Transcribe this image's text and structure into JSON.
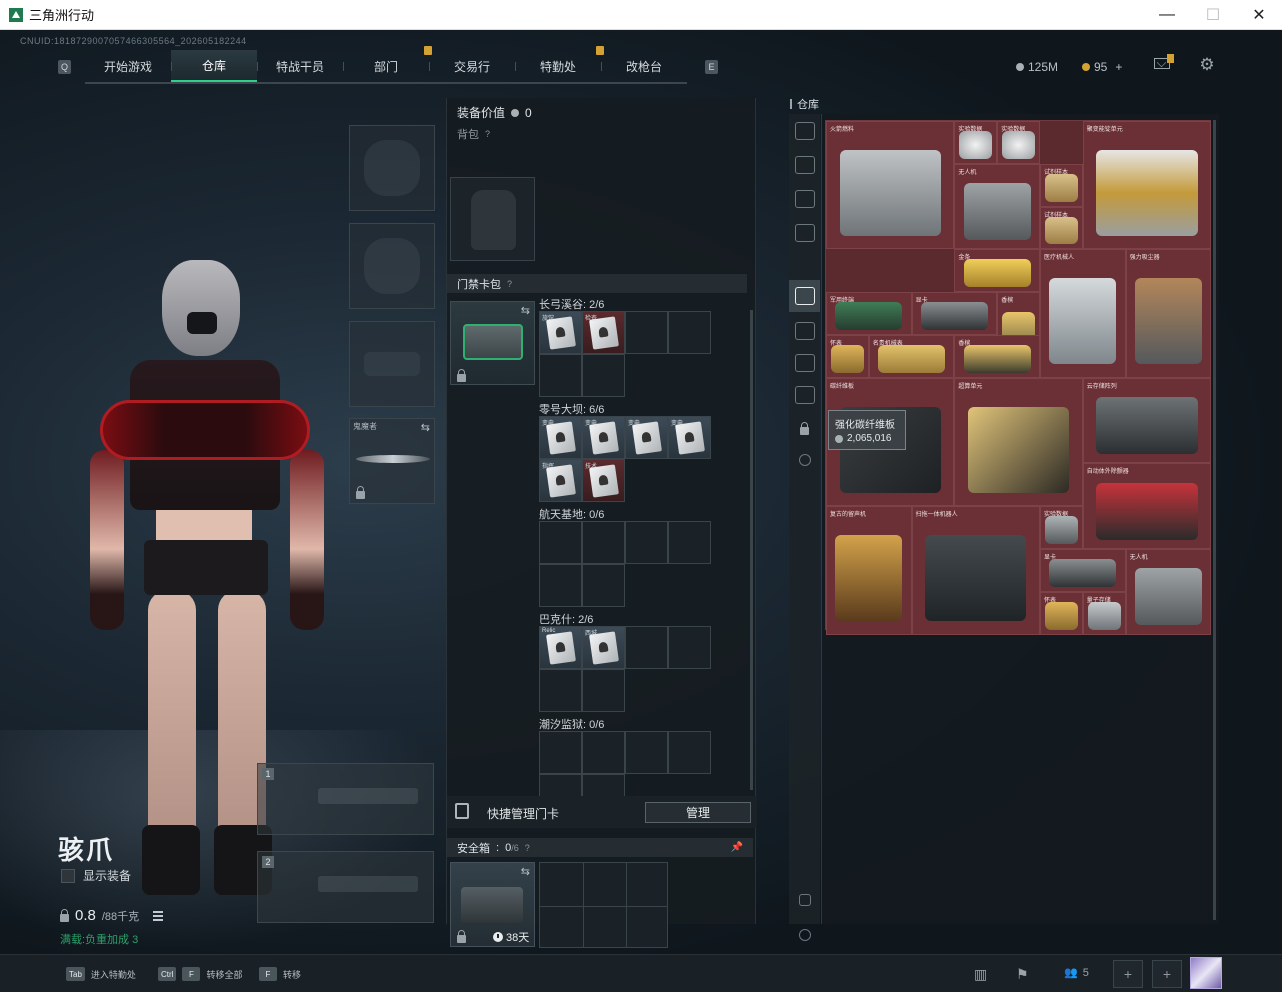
{
  "window": {
    "title": "三角洲行动",
    "minimize": "—",
    "maximize": "☐",
    "close": "✕"
  },
  "cnuid": "CNUID:1818729007057466305564_202605182244",
  "nav": {
    "left_key": "Q",
    "right_key": "E",
    "tabs": [
      {
        "label": "开始游戏",
        "badge": false
      },
      {
        "label": "仓库",
        "badge": false,
        "active": true
      },
      {
        "label": "特战干员",
        "badge": false
      },
      {
        "label": "部门",
        "badge": true
      },
      {
        "label": "交易行",
        "badge": false
      },
      {
        "label": "特勤处",
        "badge": true
      },
      {
        "label": "改枪台",
        "badge": false
      }
    ]
  },
  "currency": {
    "silver": "125M",
    "gold": "95",
    "gold_add": "+"
  },
  "operator": {
    "name": "骇爪",
    "show_equipment": "显示装备",
    "weight_current": "0.8",
    "weight_max": "/88千克",
    "stat_line": "满载:负重加成 3"
  },
  "equipment": {
    "melee_label": "鬼魔者"
  },
  "weapon_slots": [
    "1",
    "2"
  ],
  "middle": {
    "equip_value_label": "装备价值",
    "equip_value": "0",
    "backpack_label": "背包",
    "keycard_label": "门禁卡包",
    "maps": [
      {
        "label": "长弓溪谷: 2/6"
      },
      {
        "label": "零号大坝: 6/6"
      },
      {
        "label": "航天基地: 0/6"
      },
      {
        "label": "巴克什: 2/6"
      },
      {
        "label": "潮汐监狱: 0/6"
      }
    ],
    "card_labels": {
      "longbow": [
        "旅馆",
        "检查"
      ],
      "dam": [
        "变电",
        "变电",
        "变电",
        "变电",
        "指挥",
        "技术"
      ],
      "bakesh": [
        "Relic",
        "西城"
      ]
    },
    "quick_manage": "快捷管理门卡",
    "manage_button": "管理",
    "safe_label": "安全箱",
    "safe_count": "0",
    "safe_capacity": "/6",
    "safe_time": "38天"
  },
  "warehouse": {
    "title": "仓库",
    "items": [
      {
        "name": "火箭燃料"
      },
      {
        "name": "实验数据"
      },
      {
        "name": "实验数据"
      },
      {
        "name": "聚变能锭单元"
      },
      {
        "name": "无人机"
      },
      {
        "name": "试剂样本"
      },
      {
        "name": "试剂样本"
      },
      {
        "name": "金条"
      },
      {
        "name": "医疗机械人"
      },
      {
        "name": "强力吸尘器"
      },
      {
        "name": "军用终端"
      },
      {
        "name": "显卡"
      },
      {
        "name": "香槟"
      },
      {
        "name": "怀表"
      },
      {
        "name": "名贵机械表"
      },
      {
        "name": "香槟"
      },
      {
        "name": "碳纤维板"
      },
      {
        "name": "超算单元"
      },
      {
        "name": "云存储阵列"
      },
      {
        "name": "自动体外除颤器"
      },
      {
        "name": "复古的留声机"
      },
      {
        "name": "扫拖一体机器人"
      },
      {
        "name": "实验数据"
      },
      {
        "name": "显卡"
      },
      {
        "name": "无人机"
      },
      {
        "name": "怀表"
      },
      {
        "name": "量子存储"
      }
    ],
    "tooltip_name": "强化碳纤维板",
    "tooltip_value": "2,065,016"
  },
  "bottom": {
    "hints": [
      {
        "key": "Tab",
        "label": "进入特勤处"
      },
      {
        "key": "Ctrl",
        "key2": "F",
        "label": "转移全部"
      },
      {
        "key": "F",
        "label": "转移"
      }
    ],
    "friends_count": "5",
    "plus": "+"
  },
  "colors": {
    "accent_green": "#2fd08a",
    "badge_gold": "#d3a233",
    "warehouse_red": "#6a3035"
  }
}
